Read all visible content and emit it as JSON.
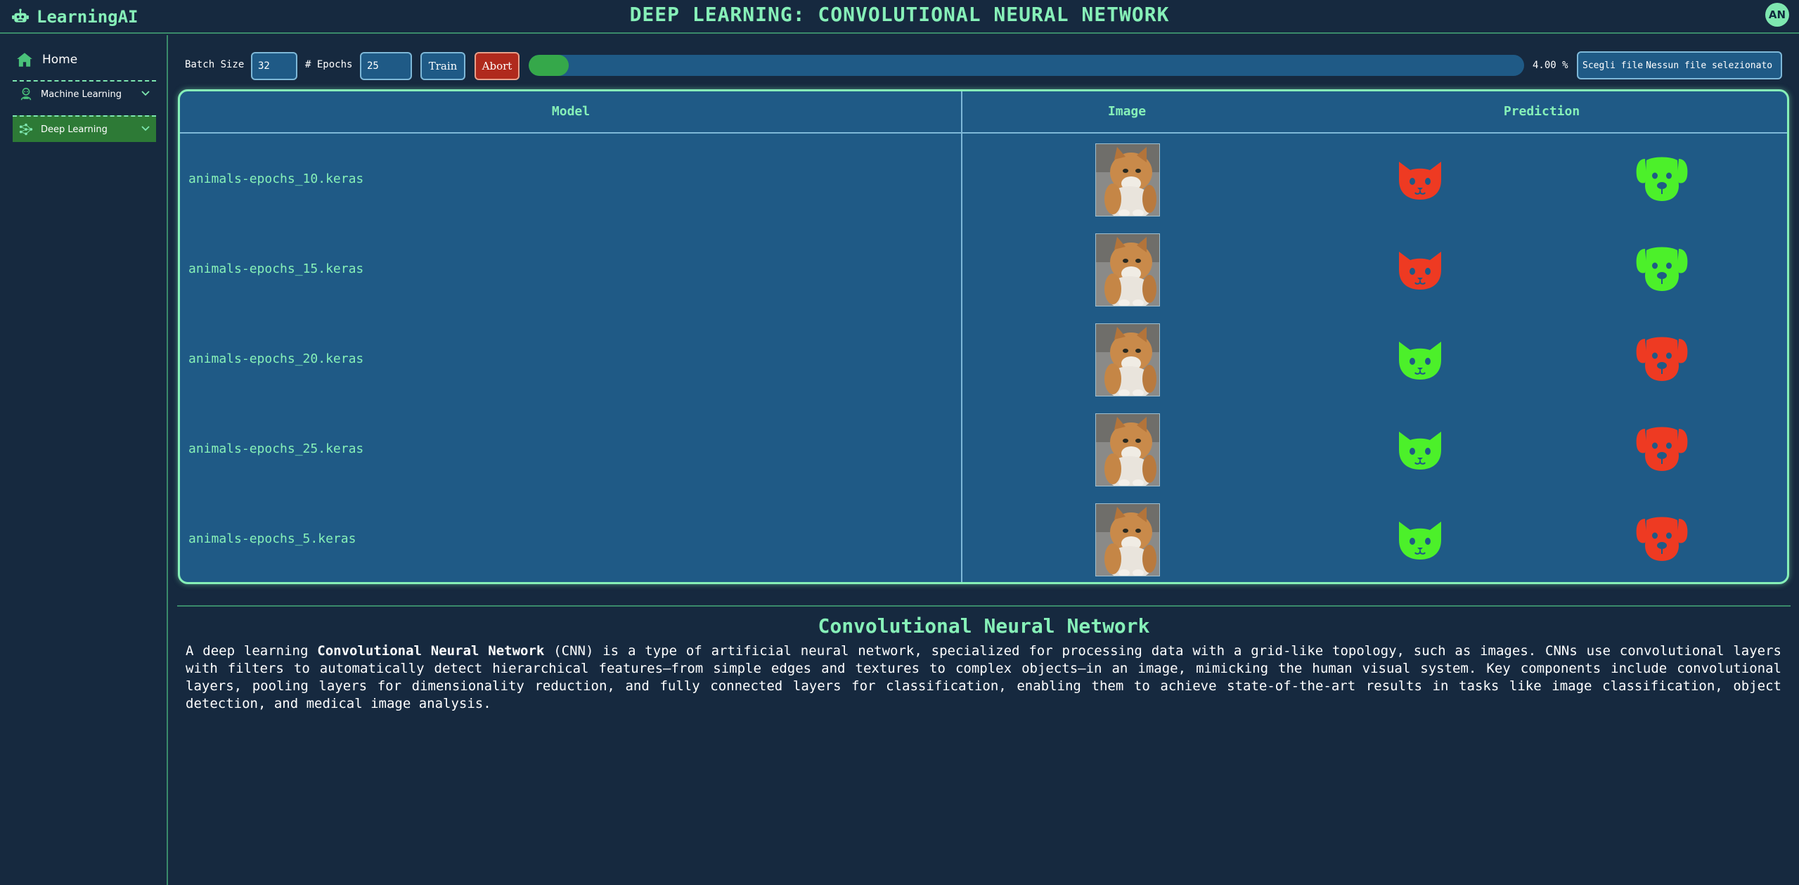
{
  "app": {
    "brand": "LearningAI",
    "page_title": "DEEP LEARNING: CONVOLUTIONAL NEURAL NETWORK",
    "avatar_initials": "AN"
  },
  "sidebar": {
    "home": "Home",
    "items": [
      {
        "label": "Machine Learning",
        "active": false
      },
      {
        "label": "Deep Learning",
        "active": true
      }
    ]
  },
  "toolbar": {
    "batch_size_label": "Batch Size",
    "batch_size_value": "32",
    "epochs_label": "# Epochs",
    "epochs_value": "25",
    "train_label": "Train",
    "abort_label": "Abort",
    "progress_percent": 4.0,
    "progress_text": "4.00 %",
    "file_button_label": "Scegli file",
    "file_status": "Nessun file selezionato"
  },
  "table": {
    "headers": {
      "model": "Model",
      "image": "Image",
      "prediction": "Prediction"
    },
    "rows": [
      {
        "model": "animals-epochs_10.keras",
        "cat_correct": false,
        "dog_correct": true
      },
      {
        "model": "animals-epochs_15.keras",
        "cat_correct": false,
        "dog_correct": true
      },
      {
        "model": "animals-epochs_20.keras",
        "cat_correct": true,
        "dog_correct": false
      },
      {
        "model": "animals-epochs_25.keras",
        "cat_correct": true,
        "dog_correct": false
      },
      {
        "model": "animals-epochs_5.keras",
        "cat_correct": true,
        "dog_correct": false
      }
    ]
  },
  "description": {
    "title": "Convolutional Neural Network",
    "intro": "A deep learning ",
    "bold": "Convolutional Neural Network",
    "body": " (CNN) is a type of artificial neural network, specialized for processing data with a grid-like topology, such as images. CNNs use convolutional layers with filters to automatically detect hierarchical features—from simple edges and textures to complex objects—in an image, mimicking the human visual system. Key components include convolutional layers, pooling layers for dimensionality reduction, and fully connected layers for classification, enabling them to achieve state-of-the-art results in tasks like image classification, object detection, and medical image analysis."
  },
  "colors": {
    "accent": "#86f0b8",
    "correct": "#4cf02a",
    "wrong": "#ee3a22",
    "background": "#16293f",
    "table_bg": "#1f5a86"
  },
  "icons": {
    "brand": "robot-icon",
    "home": "home-icon",
    "machine_learning": "robot-head-icon",
    "deep_learning": "network-icon",
    "prediction_a": "cat-icon",
    "prediction_b": "dog-icon"
  }
}
